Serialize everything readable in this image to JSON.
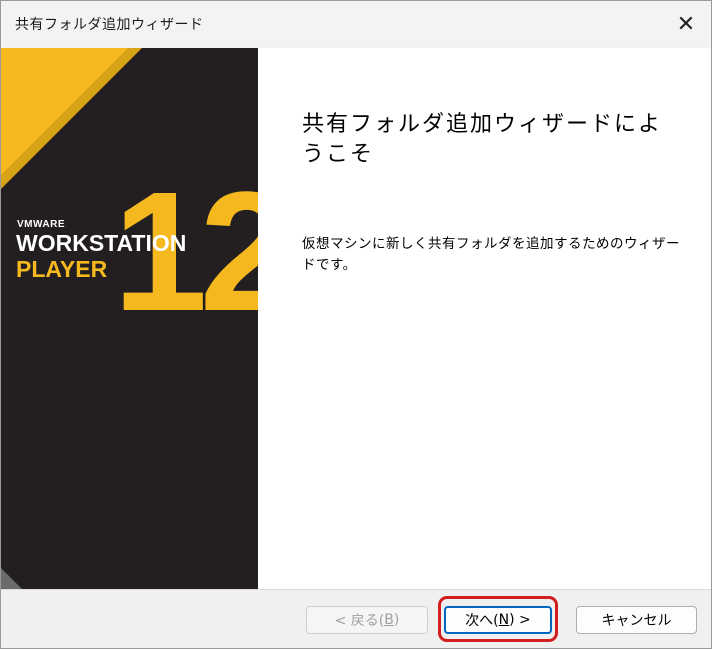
{
  "window": {
    "title": "共有フォルダ追加ウィザード",
    "close_glyph": "✕"
  },
  "banner": {
    "brand": "VMWARE",
    "product_line1": "WORKSTATION",
    "product_line2": "PLAYER",
    "version": "12",
    "colors": {
      "background": "#231f20",
      "accent": "#f5b81f",
      "text": "#ffffff"
    }
  },
  "content": {
    "heading": "共有フォルダ追加ウィザードにようこそ",
    "description": "仮想マシンに新しく共有フォルダを追加するためのウィザードです。"
  },
  "buttons": {
    "back": {
      "prefix": "< 戻る(",
      "key": "B",
      "suffix": ")"
    },
    "next": {
      "prefix": "次へ(",
      "key": "N",
      "suffix": ") >"
    },
    "cancel": "キャンセル"
  },
  "colors": {
    "highlight": "#d21e1e",
    "primary_border": "#0067c0"
  }
}
